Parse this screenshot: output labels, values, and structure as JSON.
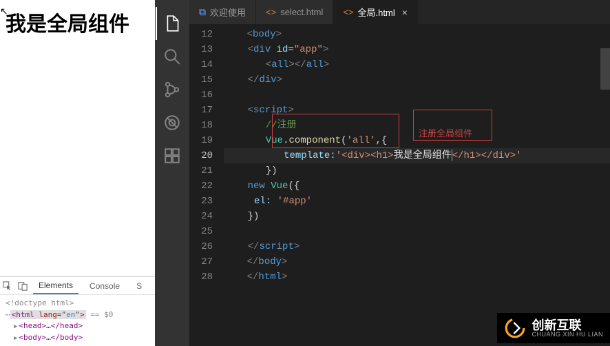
{
  "preview": {
    "heading": "我是全局组件"
  },
  "devtools": {
    "tabs": {
      "elements": "Elements",
      "console": "Console",
      "extra": "S"
    },
    "doctype": "<!doctype html>",
    "html_open_prefix": "<html ",
    "html_lang_attr": "lang",
    "html_lang_val": "en",
    "html_open_suffix": ">",
    "eq_sel": " == $0",
    "head_open": "<head>",
    "head_ellipsis": "…",
    "head_close": "</head>",
    "body_open": "<body>",
    "body_ellipsis": "…",
    "body_close": "</body>"
  },
  "tabs": {
    "welcome": "欢迎使用",
    "select": "select.html",
    "global": "全局.html"
  },
  "code": {
    "ln12": "<body>",
    "ln13_a": "<",
    "ln13_b": "div ",
    "ln13_c": "id",
    "ln13_d": "=",
    "ln13_e": "\"app\"",
    "ln13_f": ">",
    "ln14_a": "<",
    "ln14_b": "all",
    "ln14_c": "></",
    "ln14_d": "all",
    "ln14_e": ">",
    "ln15_a": "</",
    "ln15_b": "div",
    "ln15_c": ">",
    "ln17_a": "<",
    "ln17_b": "script",
    "ln17_c": ">",
    "ln18": "//注册",
    "ln19_a": "Vue",
    "ln19_b": ".",
    "ln19_c": "component",
    "ln19_d": "(",
    "ln19_e": "'all'",
    "ln19_f": ",{",
    "ln20_a": "template:",
    "ln20_b": "'<div><h1>",
    "ln20_c": "我是全局组件",
    "ln20_d": "</h1></div>'",
    "ln21": "})",
    "ln22_a": "new ",
    "ln22_b": "Vue",
    "ln22_c": "({",
    "ln23_a": "el: ",
    "ln23_b": "'#app'",
    "ln24": "})",
    "ln26_a": "</",
    "ln26_b": "script",
    "ln26_c": ">",
    "ln27_a": "</",
    "ln27_b": "body",
    "ln27_c": ">",
    "ln28_a": "</",
    "ln28_b": "html",
    "ln28_c": ">"
  },
  "annotation": {
    "label": "注册全局组件"
  },
  "line_numbers": [
    "12",
    "13",
    "14",
    "15",
    "16",
    "17",
    "18",
    "19",
    "20",
    "21",
    "22",
    "23",
    "24",
    "25",
    "26",
    "27",
    "28"
  ],
  "current_line": "20",
  "watermark": {
    "title": "创新互联",
    "sub": "CHUANG XIN HU LIAN"
  }
}
